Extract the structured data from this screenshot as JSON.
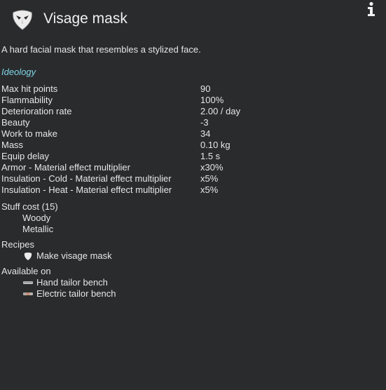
{
  "header": {
    "title": "Visage mask",
    "icon": "visage-mask-icon",
    "info_icon": "info-icon"
  },
  "description": "A hard facial mask that resembles a stylized face.",
  "section": {
    "label": "Ideology",
    "color": "#7fd6e8"
  },
  "stats": [
    {
      "label": "Max hit points",
      "value": "90"
    },
    {
      "label": "Flammability",
      "value": "100%"
    },
    {
      "label": "Deterioration rate",
      "value": "2.00 / day"
    },
    {
      "label": "Beauty",
      "value": "-3"
    },
    {
      "label": "Work to make",
      "value": "34"
    },
    {
      "label": "Mass",
      "value": "0.10 kg"
    },
    {
      "label": "Equip delay",
      "value": "1.5 s"
    },
    {
      "label": "Armor - Material effect multiplier",
      "value": "x30%"
    },
    {
      "label": "Insulation - Cold - Material effect multiplier",
      "value": "x5%"
    },
    {
      "label": "Insulation - Heat - Material effect multiplier",
      "value": "x5%"
    }
  ],
  "stuff_cost": {
    "title": "Stuff cost (15)",
    "items": [
      "Woody",
      "Metallic"
    ]
  },
  "recipes": {
    "title": "Recipes",
    "items": [
      {
        "label": "Make visage mask",
        "icon": "visage-mask-small-icon"
      }
    ]
  },
  "available_on": {
    "title": "Available on",
    "items": [
      {
        "label": "Hand tailor bench",
        "icon": "hand-tailor-bench-icon"
      },
      {
        "label": "Electric tailor bench",
        "icon": "electric-tailor-bench-icon"
      }
    ]
  }
}
